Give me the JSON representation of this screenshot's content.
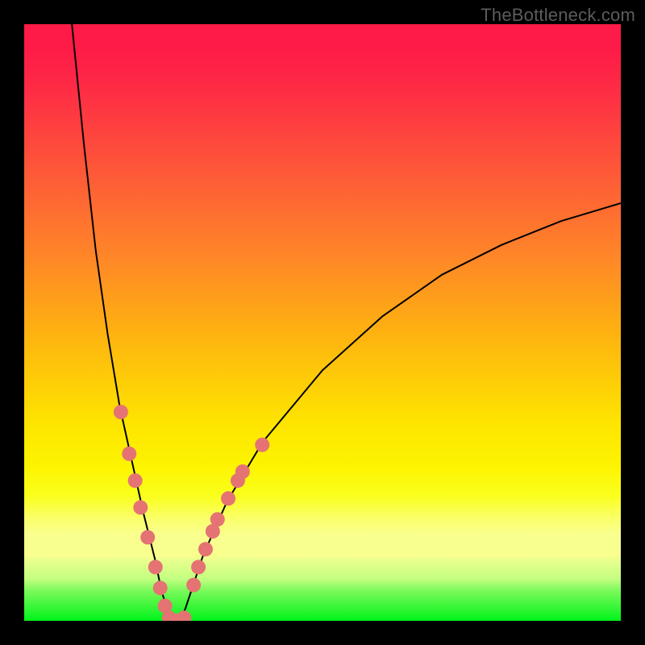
{
  "attribution": "TheBottleneck.com",
  "chart_data": {
    "type": "line",
    "title": "",
    "xlabel": "",
    "ylabel": "",
    "xlim": [
      0,
      100
    ],
    "ylim": [
      0,
      100
    ],
    "background_gradient": {
      "top_color": "#fe1b47",
      "mid_color": "#fee500",
      "bottom_color": "#00f31a"
    },
    "frame_color": "#000000",
    "curve": {
      "description": "V-shaped bottleneck curve reaching y=0 around x≈25, rising steeply to y≈100 at x≈8 on the left and gradually to y≈70 at x=100 on the right.",
      "x": [
        8,
        10,
        12,
        14,
        16,
        18,
        20,
        22,
        23,
        24,
        25,
        26,
        27,
        28,
        30,
        34,
        40,
        50,
        60,
        70,
        80,
        90,
        100
      ],
      "y": [
        100,
        80,
        62,
        48,
        36,
        27,
        18,
        10,
        5,
        2,
        0,
        0,
        2,
        5,
        11,
        20,
        30,
        42,
        51,
        58,
        63,
        67,
        70
      ],
      "color": "#000000",
      "width": 2
    },
    "series": [
      {
        "name": "markers-left",
        "type": "scatter",
        "x": [
          16.2,
          17.6,
          18.6,
          19.5,
          20.7,
          22.0,
          22.8,
          23.6,
          24.3
        ],
        "y": [
          35,
          28,
          23.5,
          19,
          14,
          9,
          5.5,
          2.5,
          0.5
        ],
        "marker_color": "#e57373",
        "marker_radius": 9
      },
      {
        "name": "markers-bottom",
        "type": "scatter",
        "x": [
          25.4,
          26.8
        ],
        "y": [
          0,
          0.5
        ],
        "marker_color": "#e57373",
        "marker_radius": 9
      },
      {
        "name": "markers-right",
        "type": "scatter",
        "x": [
          28.4,
          29.2,
          30.4,
          31.6,
          32.4,
          34.2,
          35.8,
          36.6,
          39.9
        ],
        "y": [
          6,
          9,
          12,
          15,
          17,
          20.5,
          23.5,
          25,
          29.5
        ],
        "marker_color": "#e57373",
        "marker_radius": 9
      }
    ]
  }
}
